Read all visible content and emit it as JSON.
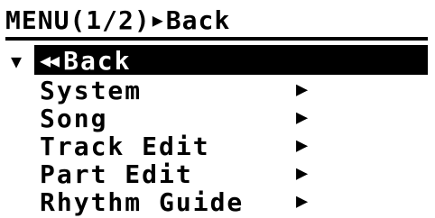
{
  "header": {
    "menu_label": "MENU(1/2)",
    "triangle_icon": "right-triangle",
    "back_label": "Back"
  },
  "menu": {
    "cursor_icon": "down-triangle",
    "items": [
      {
        "label": "Back",
        "icon": "double-left-arrow",
        "selected": true
      },
      {
        "label": "System",
        "arrow": "right-triangle"
      },
      {
        "label": "Song",
        "arrow": "right-triangle"
      },
      {
        "label": "Track Edit",
        "arrow": "right-triangle"
      },
      {
        "label": "Part Edit",
        "arrow": "right-triangle"
      },
      {
        "label": "Rhythm Guide",
        "arrow": "right-triangle"
      }
    ]
  },
  "colors": {
    "background": "#ffffff",
    "foreground": "#000000"
  }
}
